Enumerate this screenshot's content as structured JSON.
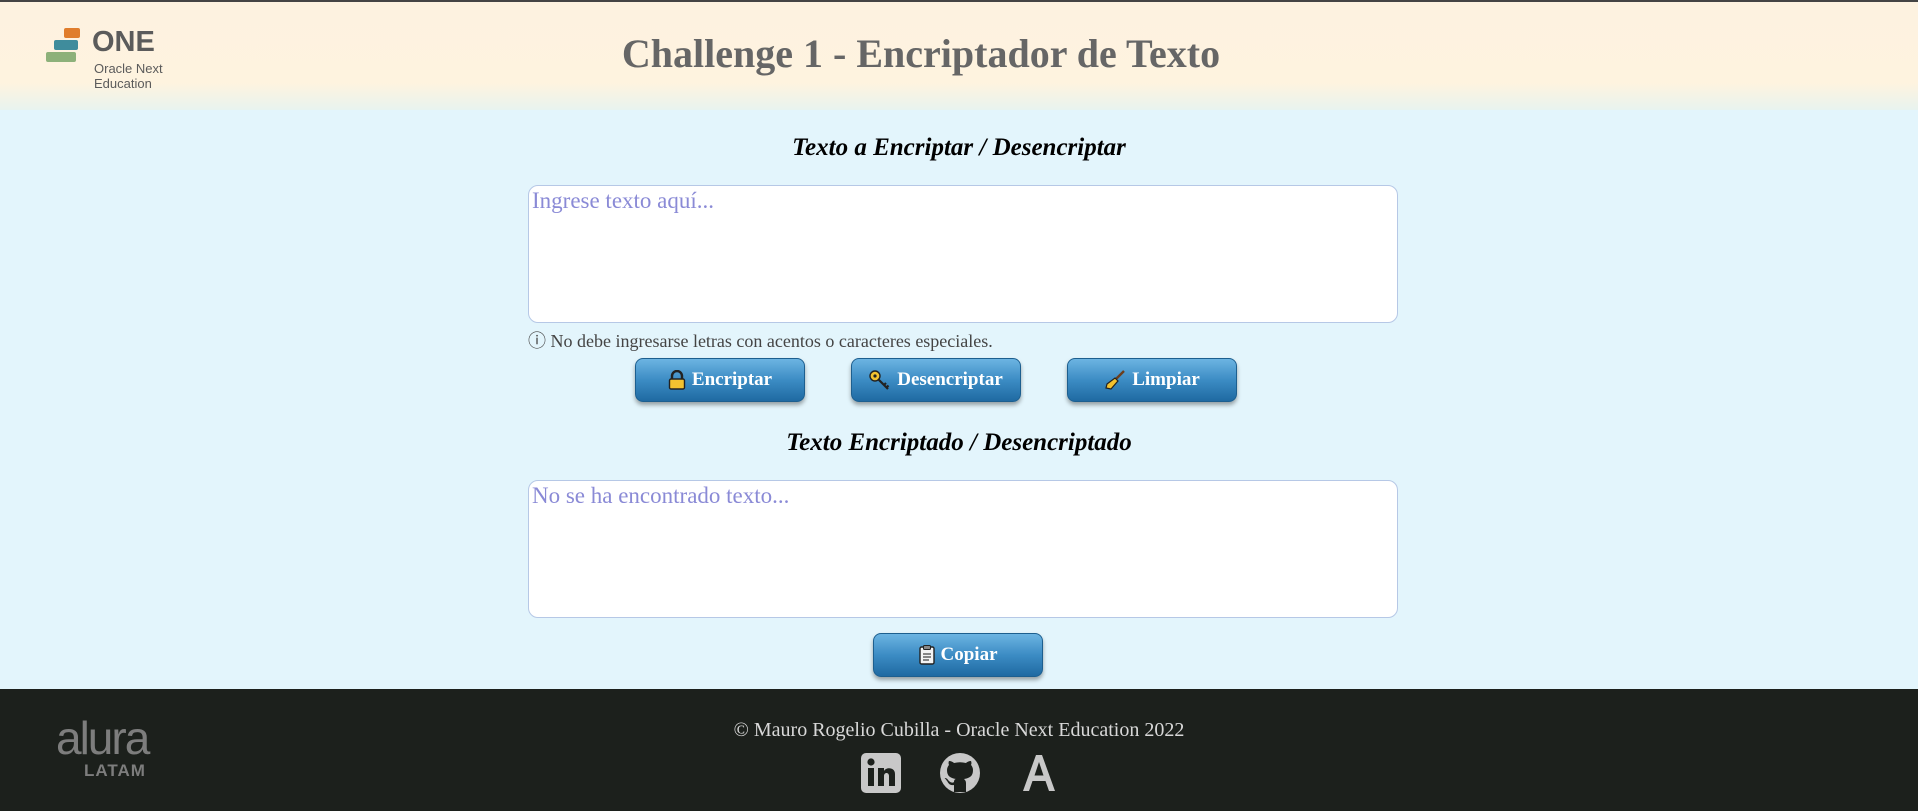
{
  "header": {
    "logo_word": "ONE",
    "logo_sub_1": "Oracle Next",
    "logo_sub_2": "Education",
    "title": "Challenge 1 - Encriptador de Texto"
  },
  "input_section": {
    "heading": "Texto a Encriptar / Desencriptar",
    "placeholder": "Ingrese texto aquí...",
    "hint": "No debe ingresarse letras con acentos o caracteres especiales.",
    "hint_icon": "ⓘ"
  },
  "actions": {
    "encrypt_label": "Encriptar",
    "decrypt_label": "Desencriptar",
    "clear_label": "Limpiar"
  },
  "output_section": {
    "heading": "Texto Encriptado / Desencriptado",
    "placeholder": "No se ha encontrado texto...",
    "copy_label": "Copiar"
  },
  "footer": {
    "brand_1": "alura",
    "brand_2": "LATAM",
    "copyright": "© Mauro Rogelio Cubilla - Oracle Next Education 2022"
  },
  "icons": [
    "lock-icon",
    "key-icon",
    "broom-icon",
    "clipboard-icon",
    "linkedin-icon",
    "github-icon",
    "alura-a-icon",
    "info-icon"
  ],
  "colors": {
    "header_bg": "#fef3df",
    "body_bg": "#e3f5fc",
    "button_blue": "#3c8cc4",
    "footer_bg": "#1c201c",
    "placeholder": "#8a8ad6"
  }
}
